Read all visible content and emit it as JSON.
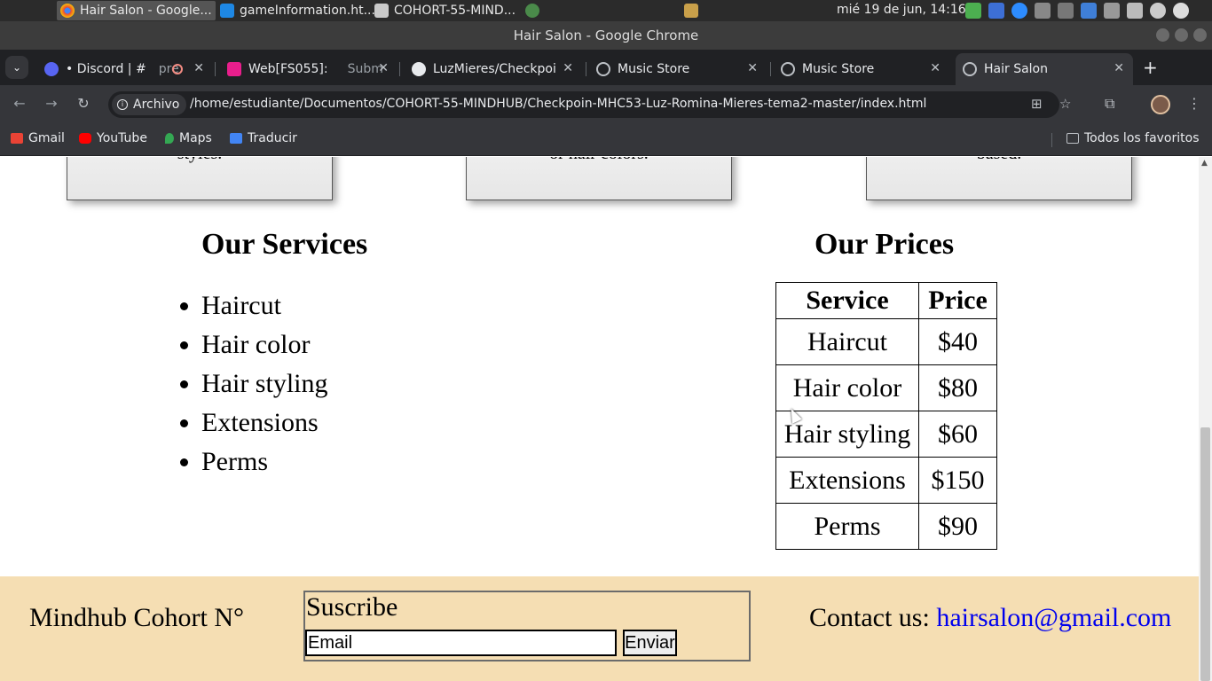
{
  "os": {
    "tasks": [
      {
        "label": "Hair Salon - Google..."
      },
      {
        "label": "gameInformation.ht..."
      },
      {
        "label": "COHORT-55-MIND..."
      }
    ],
    "clock": "mié 19 de jun, 14:16"
  },
  "window": {
    "title": "Hair Salon - Google Chrome"
  },
  "tabs": [
    {
      "label": "• Discord | #",
      "extra": "pre"
    },
    {
      "label": "Web[FS055]:",
      "extra": "Subm"
    },
    {
      "label": "LuzMieres/Checkpoi"
    },
    {
      "label": "Music Store"
    },
    {
      "label": "Music Store"
    },
    {
      "label": "Hair Salon"
    }
  ],
  "toolbar": {
    "chip_label": "Archivo",
    "url": "/home/estudiante/Documentos/COHORT-55-MINDHUB/Checkpoin-MHC53-Luz-Romina-Mieres-tema2-master/index.html"
  },
  "bookmarks": {
    "items": [
      "Gmail",
      "YouTube",
      "Maps",
      "Traducir"
    ],
    "all_favorites": "Todos los favoritos"
  },
  "page": {
    "cards": [
      "styles.",
      "or hair colors.",
      "based."
    ],
    "services": {
      "title": "Our Services",
      "items": [
        "Haircut",
        "Hair color",
        "Hair styling",
        "Extensions",
        "Perms"
      ]
    },
    "prices": {
      "title": "Our Prices",
      "headers": [
        "Service",
        "Price"
      ],
      "rows": [
        [
          "Haircut",
          "$40"
        ],
        [
          "Hair color",
          "$80"
        ],
        [
          "Hair styling",
          "$60"
        ],
        [
          "Extensions",
          "$150"
        ],
        [
          "Perms",
          "$90"
        ]
      ]
    },
    "footer": {
      "brand": "Mindhub Cohort N°",
      "subscribe_title": "Suscribe",
      "email_placeholder": "Email",
      "send_label": "Enviar",
      "contact_label": "Contact us:",
      "contact_email": "hairsalon@gmail.com"
    }
  },
  "colors": {
    "footer_bg": "#f5deb3",
    "link": "#0000ee",
    "chrome_dark": "#202124"
  }
}
